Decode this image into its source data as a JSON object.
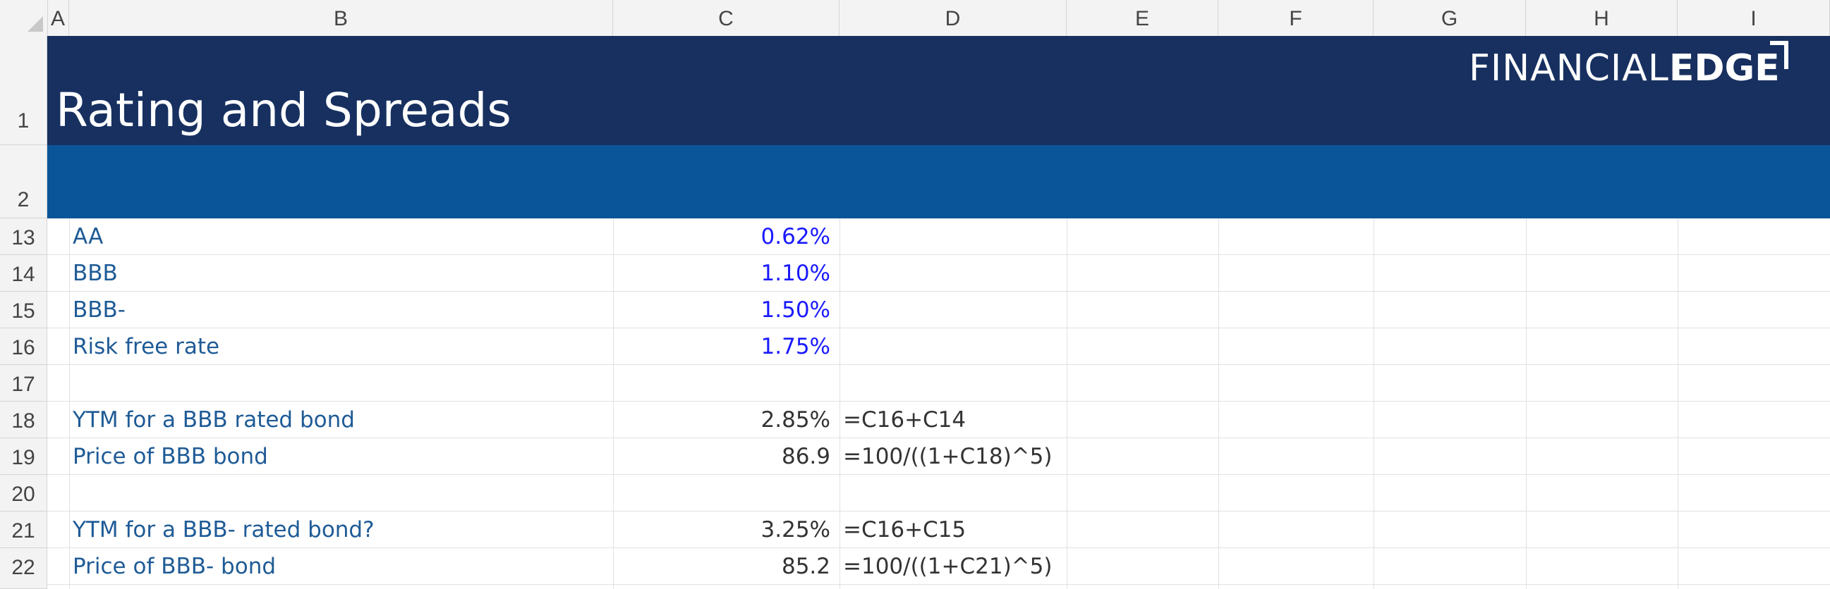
{
  "columns": [
    "A",
    "B",
    "C",
    "D",
    "E",
    "F",
    "G",
    "H",
    "I"
  ],
  "header": {
    "title": "Rating and Spreads",
    "logo_light": "FINANCIAL",
    "logo_bold": "EDGE"
  },
  "colors": {
    "title_band": "#173060",
    "sub_band": "#0a5599",
    "label_text": "#1f5b96",
    "input_text": "#1a1aff",
    "calc_text": "#333333"
  },
  "rows": [
    {
      "num": "1",
      "label": "",
      "value": "",
      "formula": ""
    },
    {
      "num": "2",
      "label": "",
      "value": "",
      "formula": ""
    },
    {
      "num": "13",
      "label": "AA",
      "value": "0.62%",
      "formula": "",
      "kind": "input"
    },
    {
      "num": "14",
      "label": "BBB",
      "value": "1.10%",
      "formula": "",
      "kind": "input"
    },
    {
      "num": "15",
      "label": "BBB-",
      "value": "1.50%",
      "formula": "",
      "kind": "input"
    },
    {
      "num": "16",
      "label": "Risk free rate",
      "value": "1.75%",
      "formula": "",
      "kind": "input"
    },
    {
      "num": "17",
      "label": "",
      "value": "",
      "formula": ""
    },
    {
      "num": "18",
      "label": "YTM for a BBB rated bond",
      "value": "2.85%",
      "formula": "=C16+C14",
      "kind": "calc"
    },
    {
      "num": "19",
      "label": "Price of BBB bond",
      "value": "86.9",
      "formula": "=100/((1+C18)^5)",
      "kind": "calc"
    },
    {
      "num": "20",
      "label": "",
      "value": "",
      "formula": ""
    },
    {
      "num": "21",
      "label": "YTM for a BBB- rated bond?",
      "value": "3.25%",
      "formula": "=C16+C15",
      "kind": "calc"
    },
    {
      "num": "22",
      "label": "Price of BBB- bond",
      "value": "85.2",
      "formula": "=100/((1+C21)^5)",
      "kind": "calc"
    }
  ]
}
